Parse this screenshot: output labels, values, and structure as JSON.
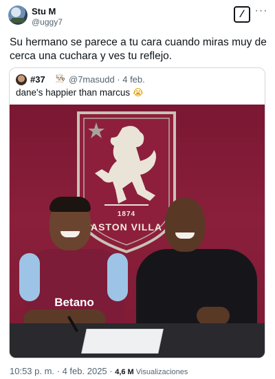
{
  "author": {
    "name": "Stu M",
    "handle": "@uggy7"
  },
  "header": {
    "grok_icon": "grok-icon",
    "more_icon": "more-options-icon",
    "more_glyph": "···"
  },
  "tweet": {
    "text": "Su hermano se parece a tu cara cuando miras muy de cerca una cuchara y ves tu reflejo."
  },
  "quote": {
    "name": "#37",
    "name_emoji": "👨🏻‍🍳",
    "handle_date": "@7masudd · 4 feb.",
    "text": "dane's happier than marcus",
    "text_emoji": "😭",
    "photo": {
      "crest_year": "1874",
      "crest_club": "ASTON VILLA",
      "shirt_sponsor": "Betano"
    }
  },
  "footer": {
    "time": "10:53 p. m. · 4 feb. 2025 · ",
    "views_count": "4,6 M",
    "views_label": " Visualizaciones"
  },
  "colors": {
    "text_primary": "#0f1419",
    "text_secondary": "#536471",
    "border": "#cfd9de",
    "claret": "#7a1732",
    "sky_blue": "#9dc4e6"
  }
}
